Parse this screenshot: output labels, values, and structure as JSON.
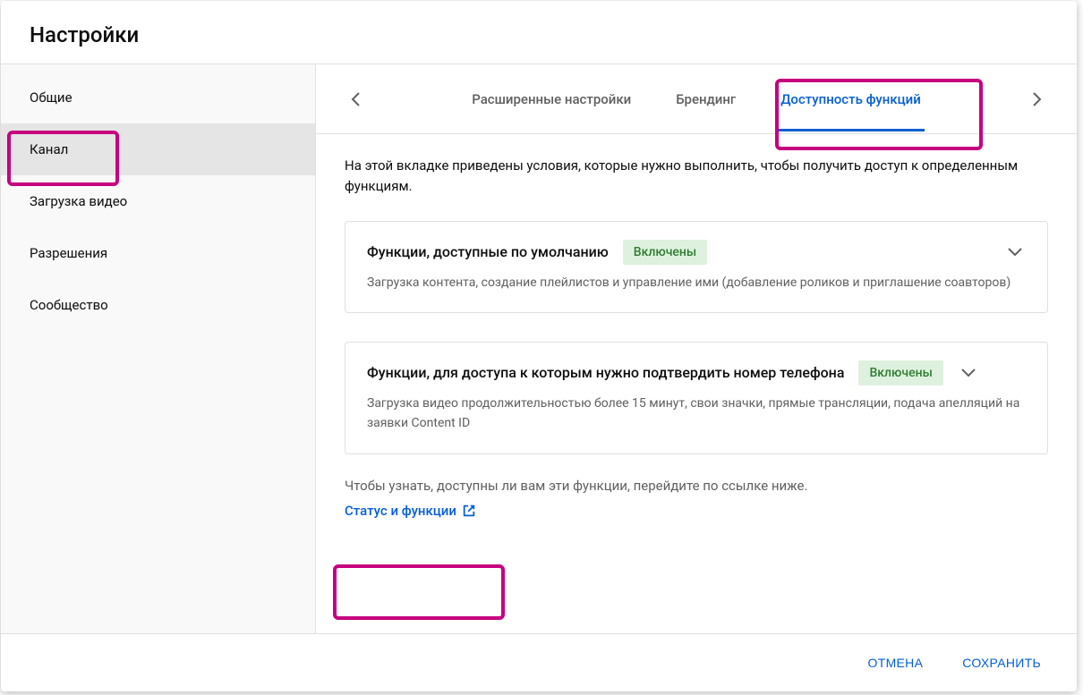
{
  "header": {
    "title": "Настройки"
  },
  "sidebar": {
    "items": [
      {
        "label": "Общие"
      },
      {
        "label": "Канал"
      },
      {
        "label": "Загрузка видео"
      },
      {
        "label": "Разрешения"
      },
      {
        "label": "Сообщество"
      }
    ],
    "active_index": 1
  },
  "tabs": {
    "items": [
      {
        "label": "Расширенные настройки"
      },
      {
        "label": "Брендинг"
      },
      {
        "label": "Доступность функций"
      }
    ],
    "active_index": 2
  },
  "content": {
    "intro": "На этой вкладке приведены условия, которые нужно выполнить, чтобы получить доступ к определенным функциям.",
    "cards": [
      {
        "title": "Функции, доступные по умолчанию",
        "badge": "Включены",
        "desc": "Загрузка контента, создание плейлистов и управление ими (добавление роликов и приглашение соавторов)"
      },
      {
        "title": "Функции, для доступа к которым нужно подтвердить номер телефона",
        "badge": "Включены",
        "desc": "Загрузка видео продолжительностью более 15 минут, свои значки, прямые трансляции, подача апелляций на заявки Content ID"
      }
    ],
    "footer_text": "Чтобы узнать, доступны ли вам эти функции, перейдите по ссылке ниже.",
    "link_label": "Статус и функции"
  },
  "footer": {
    "cancel": "ОТМЕНА",
    "save": "СОХРАНИТЬ"
  }
}
